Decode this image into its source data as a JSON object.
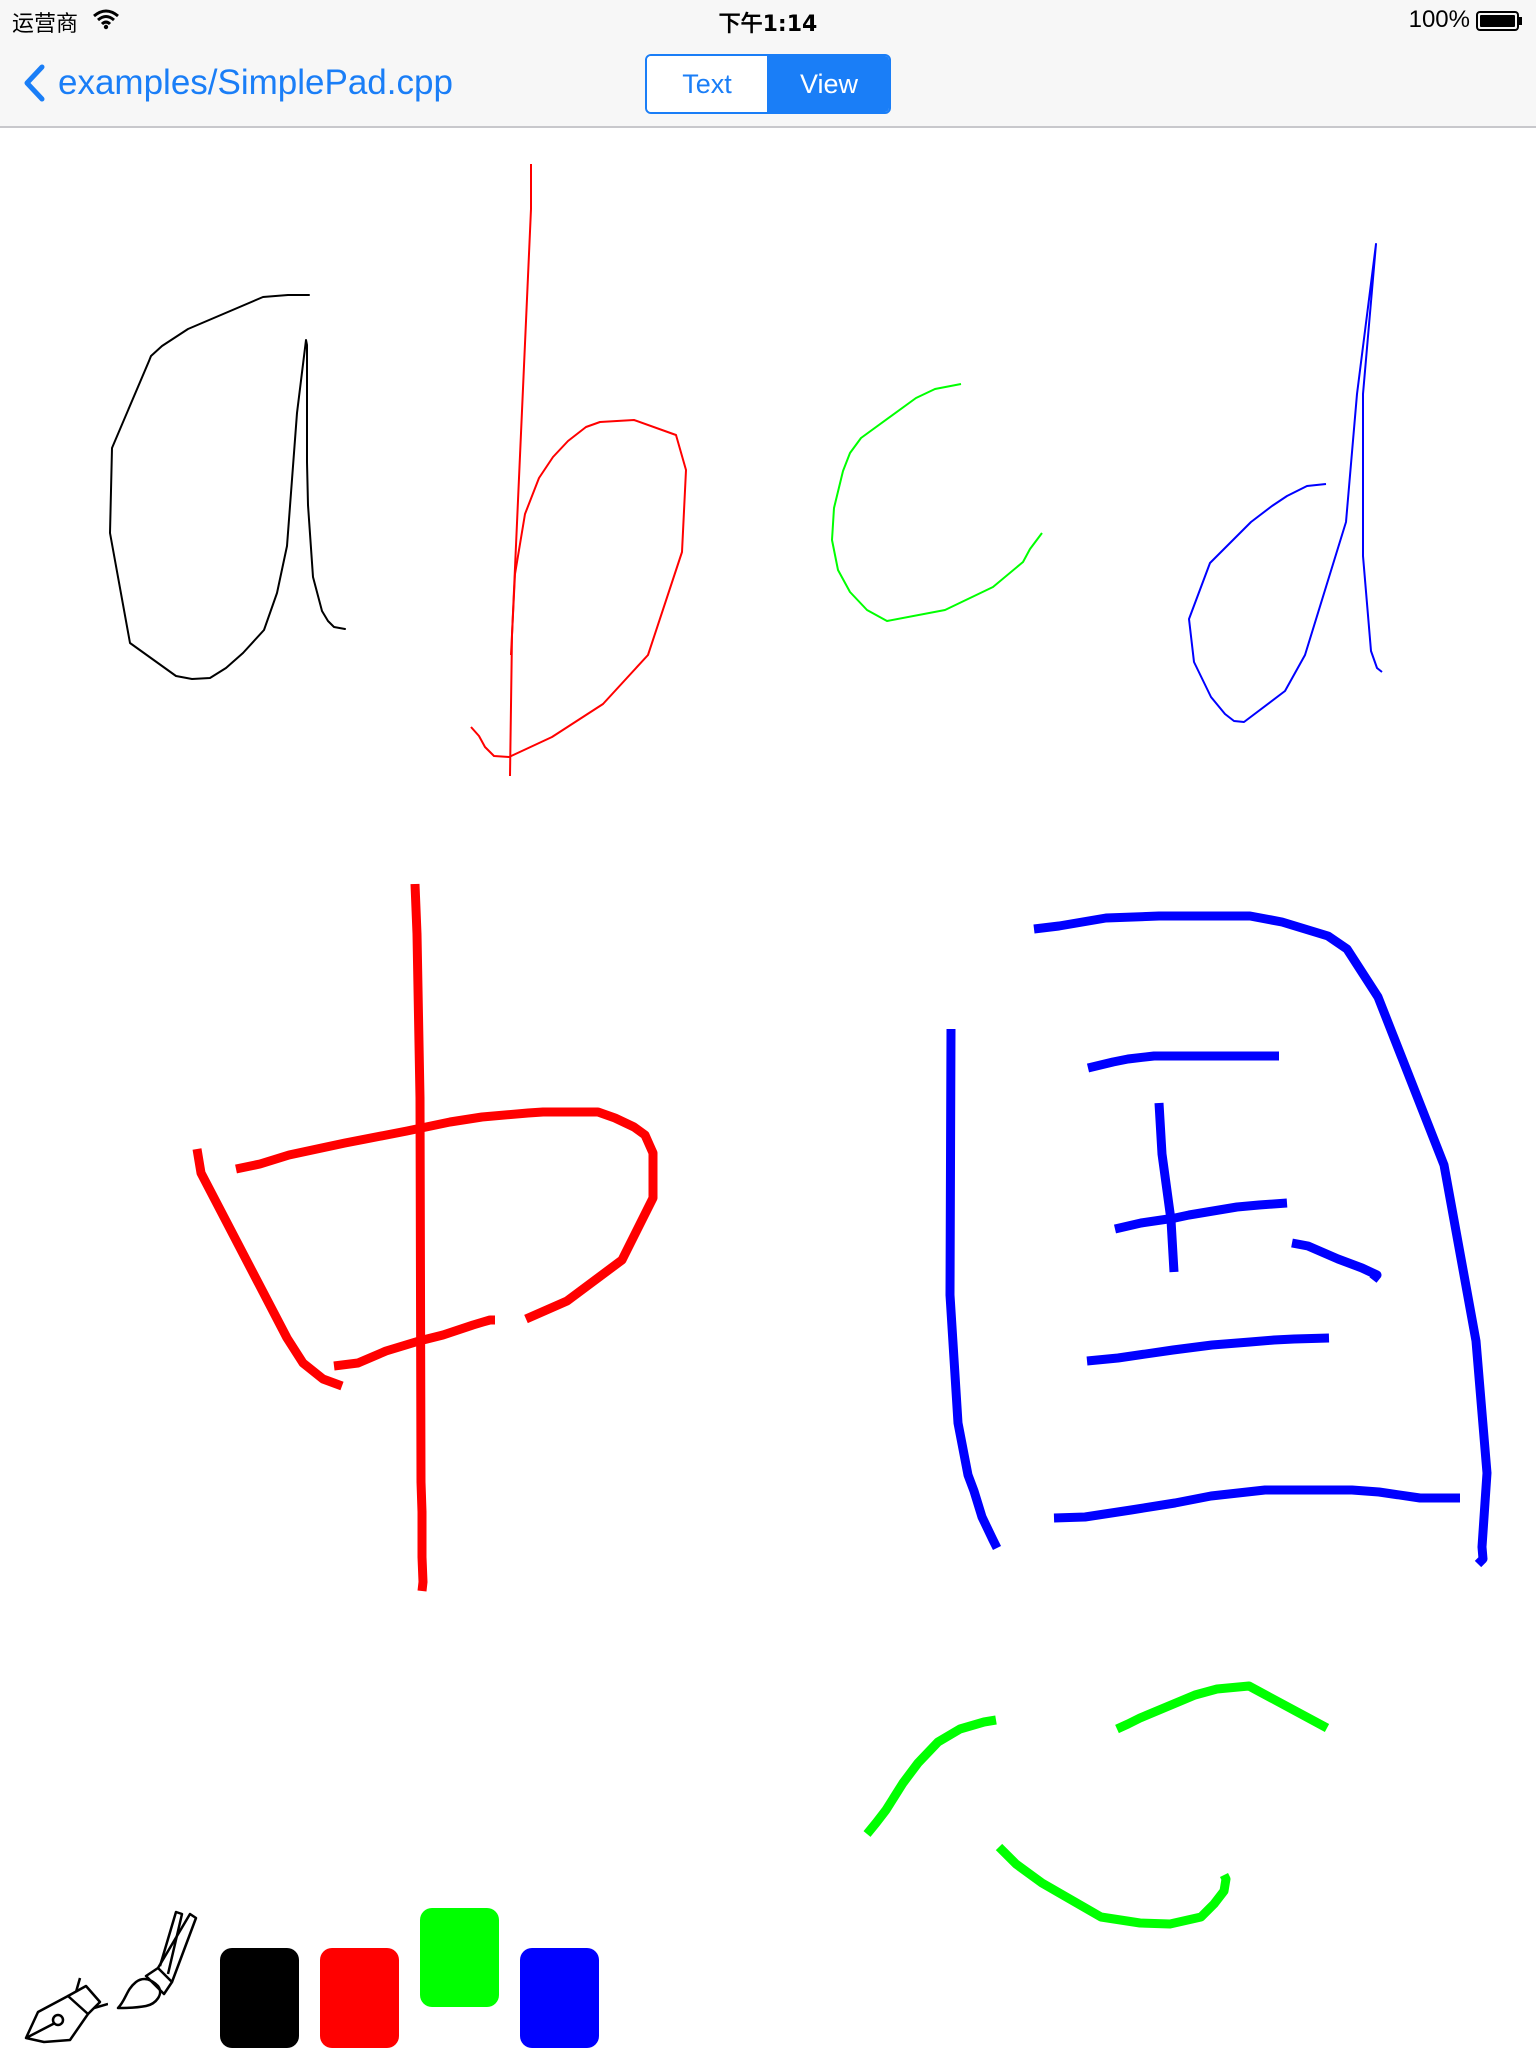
{
  "status_bar": {
    "carrier": "运营商",
    "time": "下午1:14",
    "battery": "100%"
  },
  "nav": {
    "back_label": "examples/SimplePad.cpp",
    "segments": [
      "Text",
      "View"
    ],
    "selected_segment": "View"
  },
  "colors": {
    "accent": "#1a7ef7",
    "black": "#000000",
    "red": "#ff0000",
    "green": "#00ff00",
    "blue": "#0000ff"
  },
  "toolbar": {
    "tools": [
      "pen-nib-icon",
      "brush-icon"
    ],
    "swatches": [
      {
        "name": "black",
        "color": "#000000",
        "selected": false
      },
      {
        "name": "red",
        "color": "#ff0000",
        "selected": false
      },
      {
        "name": "green",
        "color": "#00ff00",
        "selected": true
      },
      {
        "name": "blue",
        "color": "#0000ff",
        "selected": false
      }
    ]
  }
}
